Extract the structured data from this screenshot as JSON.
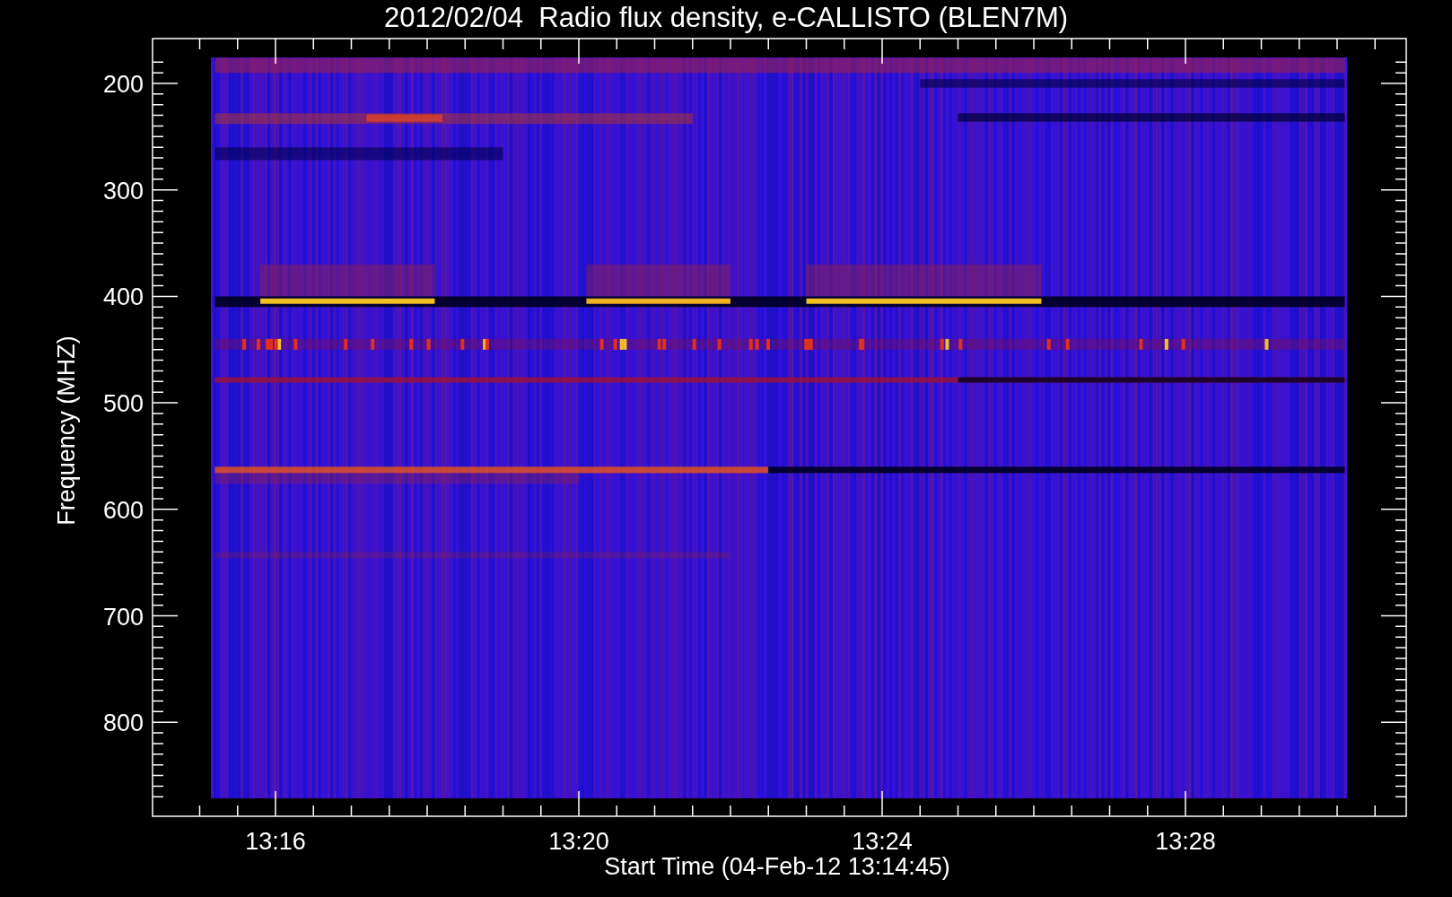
{
  "title": "2012/02/04  Radio flux density, e-CALLISTO (BLEN7M)",
  "y_axis": {
    "label": "Frequency (MHZ)",
    "ticks": [
      "200",
      "300",
      "400",
      "500",
      "600",
      "700",
      "800"
    ]
  },
  "x_axis": {
    "label": "Start Time (04-Feb-12 13:14:45)",
    "ticks": [
      "13:16",
      "13:20",
      "13:24",
      "13:28"
    ]
  }
}
